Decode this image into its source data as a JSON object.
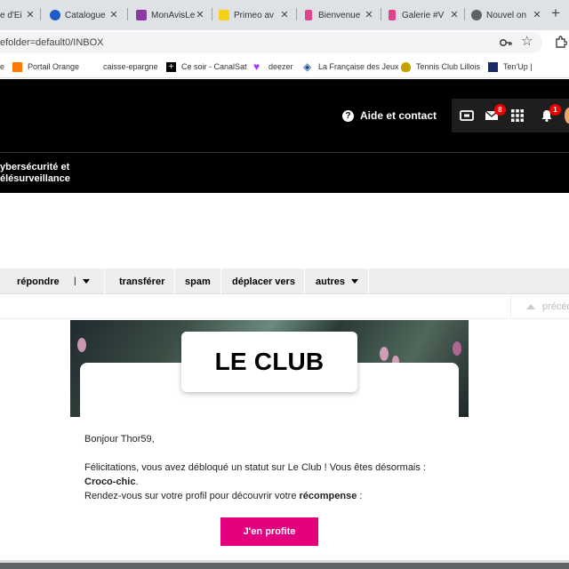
{
  "browser": {
    "tabs": [
      {
        "title": "e d'Ei",
        "color": "#ffffff"
      },
      {
        "title": "Catalogue",
        "color": "#1e5bc6"
      },
      {
        "title": "MonAvisLe",
        "color": "#8a3aa0"
      },
      {
        "title": "Primeo av",
        "color": "#f7d117"
      },
      {
        "title": "Bienvenue",
        "color": "#e0458b"
      },
      {
        "title": "Galerie #V",
        "color": "#e0458b"
      },
      {
        "title": "Nouvel on",
        "color": "#5f6368"
      }
    ],
    "close_glyph": "✕",
    "new_tab_glyph": "+",
    "url": "efolder=default0/INBOX",
    "bookmarks": [
      {
        "label": "Portail Orange",
        "icon": "orange-square",
        "color": "#ff7900"
      },
      {
        "label": "caisse-epargne",
        "icon": "none",
        "color": "#ffffff"
      },
      {
        "label": "Ce soir - CanalSat",
        "icon": "plus-square",
        "color": "#000000"
      },
      {
        "label": "deezer",
        "icon": "heart",
        "color": "#a238ff"
      },
      {
        "label": "La Française des Jeux",
        "icon": "diamond",
        "color": "#1d4e9e"
      },
      {
        "label": "Tennis Club Lillois",
        "icon": "crest",
        "color": "#c8a200"
      },
      {
        "label": "Ten'Up |",
        "icon": "tenup",
        "color": "#1b2a6b"
      }
    ]
  },
  "header": {
    "help_label": "Aide et contact",
    "help_glyph": "?",
    "mail_badge": "8",
    "notif_badge": "1",
    "subnav_line1": "ybersécurité et",
    "subnav_line2": "élésurveillance"
  },
  "toolbar": {
    "reply": "répondre",
    "pipe": "|",
    "forward": "transférer",
    "spam": "spam",
    "move": "déplacer vers",
    "more": "autres",
    "previous": "précéd"
  },
  "email": {
    "hero_title": "LE CLUB",
    "greeting": "Bonjour Thor59,",
    "line1": "Félicitations, vous avez débloqué un statut sur Le Club ! Vous êtes désormais :",
    "status": "Croco-chic",
    "period": ".",
    "line2": "Rendez-vous sur votre profil pour découvrir votre ",
    "reward": "récompense",
    "colon": " :",
    "cta": "J'en profite"
  },
  "colors": {
    "accent_pink": "#e5007e",
    "badge_red": "#e00000",
    "header_black": "#000000"
  }
}
